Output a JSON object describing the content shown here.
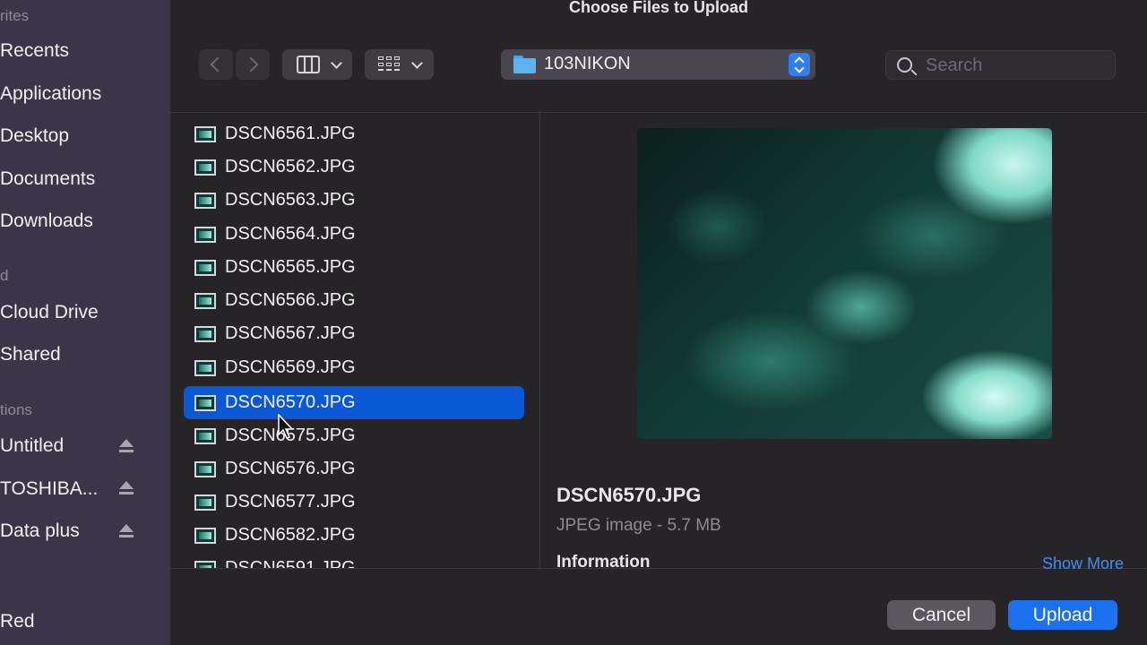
{
  "window": {
    "title": "Choose Files to Upload"
  },
  "sidebar": {
    "sections": {
      "favorites": "rites",
      "icloud": "d",
      "locations": "tions"
    },
    "favorites": [
      "Recents",
      "Applications",
      "Desktop",
      "Documents",
      "Downloads"
    ],
    "icloud": [
      "Cloud Drive",
      "Shared"
    ],
    "locations": [
      "Untitled",
      "TOSHIBA...",
      "Data plus"
    ],
    "tags": [
      "Red"
    ]
  },
  "toolbar": {
    "path": "103NIKON",
    "search_placeholder": "Search"
  },
  "files": [
    "DSCN6561.JPG",
    "DSCN6562.JPG",
    "DSCN6563.JPG",
    "DSCN6564.JPG",
    "DSCN6565.JPG",
    "DSCN6566.JPG",
    "DSCN6567.JPG",
    "DSCN6569.JPG",
    "DSCN6570.JPG",
    "DSCN6575.JPG",
    "DSCN6576.JPG",
    "DSCN6577.JPG",
    "DSCN6582.JPG",
    "DSCN6591.JPG"
  ],
  "selected_file": "DSCN6570.JPG",
  "preview": {
    "filename": "DSCN6570.JPG",
    "meta": "JPEG image - 5.7 MB",
    "info_label": "Information",
    "show_more": "Show More"
  },
  "buttons": {
    "cancel": "Cancel",
    "upload": "Upload"
  },
  "colors": {
    "accent": "#1c72ee",
    "selection": "#0a58d6",
    "sidebar": "#3a3548",
    "link": "#3f8ff7"
  },
  "icons": [
    "search-icon",
    "folder-icon",
    "eject-icon",
    "image-file-icon",
    "columns-view-icon",
    "grid-view-icon"
  ]
}
